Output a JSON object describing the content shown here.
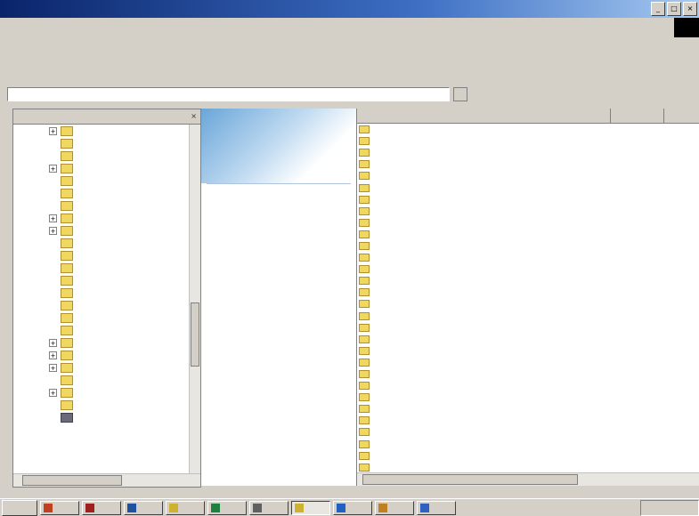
{
  "window": {
    "title": ""
  },
  "menu": [],
  "toolbar": [],
  "address": {
    "label": "",
    "value": ""
  },
  "left_pane": {
    "title": ""
  },
  "tree": [
    {
      "label": "",
      "expander": true
    },
    {
      "label": "",
      "expander": false
    },
    {
      "label": "",
      "expander": false
    },
    {
      "label": "",
      "expander": true
    },
    {
      "label": "",
      "expander": false
    },
    {
      "label": "",
      "expander": false
    },
    {
      "label": "",
      "expander": false,
      "highlight": true
    },
    {
      "label": "",
      "expander": true
    },
    {
      "label": "",
      "expander": true
    },
    {
      "label": "",
      "expander": false
    },
    {
      "label": "",
      "expander": false
    },
    {
      "label": "",
      "expander": false
    },
    {
      "label": "",
      "expander": false
    },
    {
      "label": "",
      "expander": false
    },
    {
      "label": "",
      "expander": false
    },
    {
      "label": "",
      "expander": false
    },
    {
      "label": "",
      "expander": false
    },
    {
      "label": "",
      "expander": true
    },
    {
      "label": "",
      "expander": true
    },
    {
      "label": "",
      "expander": true
    },
    {
      "label": "",
      "expander": false
    },
    {
      "label": "",
      "expander": true
    },
    {
      "label": "",
      "expander": false
    },
    {
      "label": "",
      "expander": false,
      "control_panel": true
    }
  ],
  "middle_pane": {
    "name": "",
    "big_name": "",
    "description": ""
  },
  "columns": [],
  "files": [
    "",
    "",
    "",
    "",
    "",
    "",
    "",
    "",
    "",
    "",
    "",
    "",
    "",
    "",
    "",
    "",
    "",
    "",
    "",
    "",
    "",
    "",
    "",
    "",
    "",
    "",
    "",
    "",
    "",
    ""
  ],
  "taskbar": {
    "start": "",
    "tasks": [
      {
        "color": "#c04020",
        "active": false
      },
      {
        "color": "#a02020",
        "active": false
      },
      {
        "color": "#2050a0",
        "active": false
      },
      {
        "color": "#d0b030",
        "active": false
      },
      {
        "color": "#208040",
        "active": false
      },
      {
        "color": "#606060",
        "active": false
      },
      {
        "color": "#d0b030",
        "active": true
      },
      {
        "color": "#2060c0",
        "active": false
      },
      {
        "color": "#c08020",
        "active": false
      },
      {
        "color": "#3060c0",
        "active": false
      }
    ]
  },
  "colors": {
    "title_bar": "#0a246a",
    "folder": "#f0d860",
    "highlight_tag": "#e06010",
    "chrome": "#d4d0c8"
  }
}
